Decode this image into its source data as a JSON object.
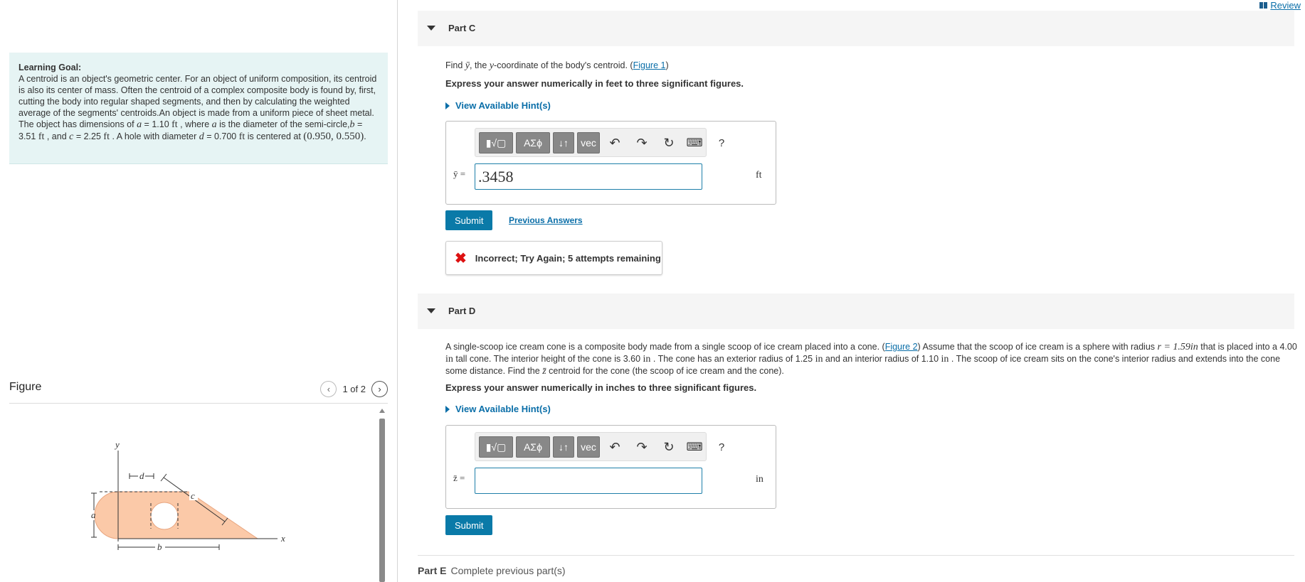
{
  "review": {
    "label": "Review"
  },
  "learning_goal": {
    "title": "Learning Goal:",
    "intro": "A centroid is an object's geometric center. For an object of uniform composition, its centroid is also its center of mass. Often the centroid of a complex composite body is found by, first, cutting the body into regular shaped segments, and then by calculating the weighted average of the segments' centroids.An object is made from a uniform piece of sheet metal. The object has dimensions of ",
    "a_sym": "a",
    "a_eq": " = 1.10 ",
    "a_unit": "ft",
    "a_tail": " , where ",
    "a_sym2": "a",
    "a_desc": " is the diameter of the semi-circle,",
    "b_sym": "b",
    "b_eq": " = 3.51 ",
    "b_unit": "ft",
    "b_tail": " , and ",
    "c_sym": "c",
    "c_eq": " = 2.25 ",
    "c_unit": "ft",
    "c_tail": " . A hole with diameter ",
    "d_sym": "d",
    "d_eq": " = 0.700 ",
    "d_unit": "ft",
    "d_tail": " is centered at ",
    "center": "(0.950, 0.550)",
    "end": "."
  },
  "figure": {
    "title": "Figure",
    "pager": "1 of 2",
    "labels": {
      "y": "y",
      "x": "x",
      "a": "a",
      "b": "b",
      "c": "c",
      "d": "d"
    }
  },
  "toolbar": {
    "templates": "▮√▢",
    "greek": "ΑΣϕ",
    "arrows": "↓↑",
    "vec": "vec",
    "undo": "↶",
    "redo": "↷",
    "reset": "↻",
    "keyboard": "⌨",
    "help": "?"
  },
  "part_c": {
    "label": "Part C",
    "find_pre": "Find ",
    "find_var": "ȳ",
    "find_mid": ", the ",
    "find_y": "y",
    "find_post": "-coordinate of the body's centroid. (",
    "figure_link": "Figure 1",
    "find_close": ")",
    "instruction": "Express your answer numerically in feet to three significant figures.",
    "hint": "View Available Hint(s)",
    "var_label": "ȳ =",
    "input_value": ".3458",
    "unit": "ft",
    "submit": "Submit",
    "previous_answers": "Previous Answers",
    "feedback": "Incorrect; Try Again; 5 attempts remaining"
  },
  "part_d": {
    "label": "Part D",
    "text_1": "A single-scoop ice cream cone is a composite body made from a single scoop of ice cream placed into a cone. (",
    "figure_link": "Figure 2",
    "text_2": ") Assume that the scoop of ice cream is a sphere with radius ",
    "r_expr": "r = 1.59in",
    "text_3": " that is placed into a 4.00 ",
    "in1": "in",
    "text_4": " tall cone. The interior height of the cone is 3.60 ",
    "in2": "in",
    "text_5": " . The cone has an exterior radius of 1.25 ",
    "in3": "in",
    "text_6": " and an interior radius of 1.10 ",
    "in4": "in",
    "text_7": " . The scoop of ice cream sits on the cone's interior radius and extends into the cone some distance. Find the ",
    "zbar": "z̄",
    "text_8": " centroid for the cone (the scoop of ice cream and the cone).",
    "instruction": "Express your answer numerically in inches to three significant figures.",
    "hint": "View Available Hint(s)",
    "var_label": "z̄ =",
    "input_value": "",
    "unit": "in",
    "submit": "Submit"
  },
  "part_e": {
    "label": "Part E",
    "status": "Complete previous part(s)"
  }
}
